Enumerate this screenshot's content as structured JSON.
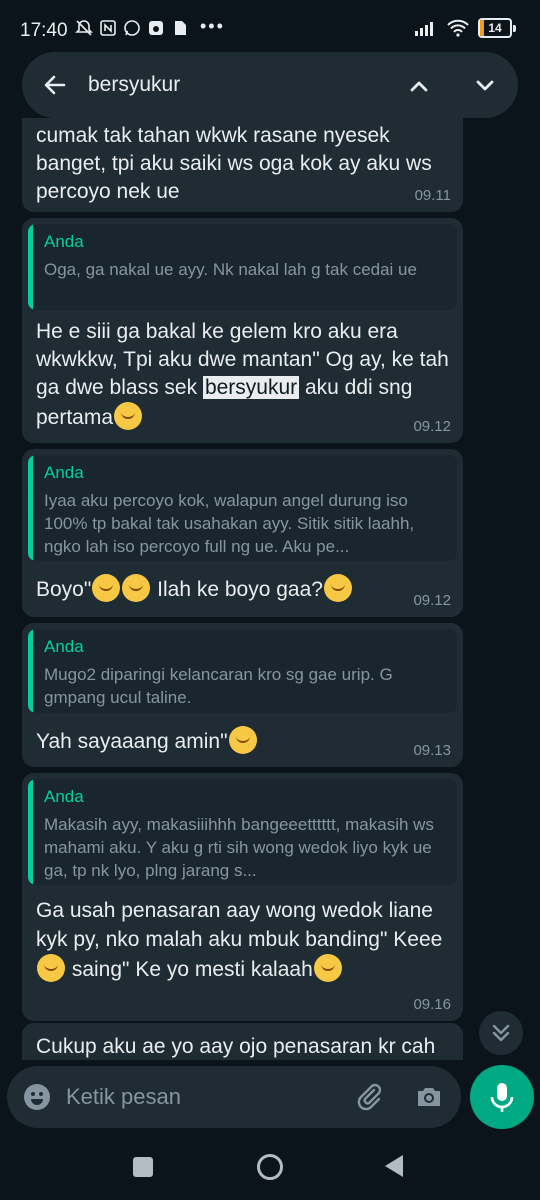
{
  "status_bar": {
    "time": "17:40",
    "battery": "14"
  },
  "search": {
    "query": "bersyukur"
  },
  "messages": [
    {
      "text": "cumak tak tahan wkwk rasane nyesek banget, tpi aku saiki ws oga kok ay aku ws percoyo nek ue",
      "time": "09.11"
    },
    {
      "quote_author": "Anda",
      "quote_text": "Oga, ga nakal ue ayy. Nk nakal lah g tak cedai ue",
      "text_before": "He e siii ga bakal ke gelem kro aku era wkwkkw, Tpi aku dwe mantan\" Og ay, ke tah ga dwe blass sek ",
      "highlight": "bersyukur",
      "text_after": " aku ddi sng pertama",
      "time": "09.12"
    },
    {
      "quote_author": "Anda",
      "quote_text": "Iyaa aku percoyo kok, walapun angel durung iso 100% tp bakal tak usahakan ayy. Sitik sitik laahh, ngko lah iso percoyo full ng ue. Aku pe...",
      "text_a": "Boyo\"",
      "text_b": " Ilah ke boyo gaa?",
      "time": "09.12"
    },
    {
      "quote_author": "Anda",
      "quote_text": "Mugo2 diparingi kelancaran kro sg gae urip. G gmpang ucul taline.",
      "text": "Yah sayaaang amin\"",
      "time": "09.13"
    },
    {
      "quote_author": "Anda",
      "quote_text": "Makasih ayy, makasiiihhh bangeeetttttt, makasih ws mahami aku. Y aku g rti sih wong wedok liyo kyk ue ga, tp nk lyo, plng jarang s...",
      "text_a": "Ga usah penasaran aay wong wedok liane kyk py, nko malah aku mbuk banding\" Keee",
      "text_b": " saing\" Ke yo mesti kalaah",
      "time": "09.16"
    },
    {
      "text": "Cukup aku ae yo aay ojo penasaran kr cah"
    }
  ],
  "input": {
    "placeholder": "Ketik pesan"
  },
  "colors": {
    "accent": "#00a884",
    "quote_author": "#06cf9c",
    "bubble": "#1f2c33",
    "background": "#0b141a"
  }
}
